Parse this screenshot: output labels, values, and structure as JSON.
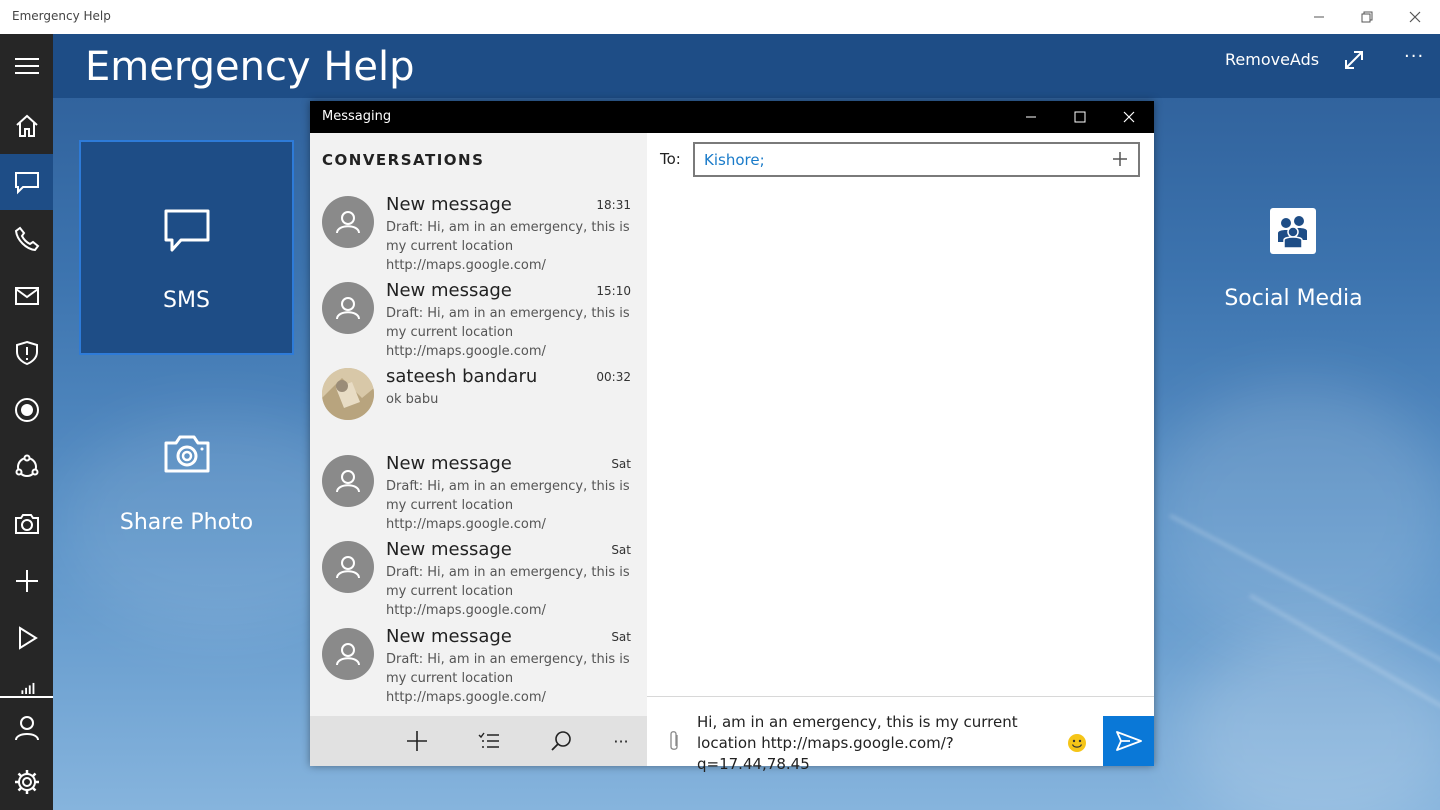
{
  "window": {
    "title": "Emergency Help"
  },
  "header": {
    "title": "Emergency Help",
    "remove_ads": "RemoveAds"
  },
  "tiles": {
    "sms": "SMS",
    "share_photo": "Share Photo",
    "social_media": "Social Media"
  },
  "messaging": {
    "title": "Messaging",
    "conversations_header": "CONVERSATIONS",
    "conversations": [
      {
        "name": "New message",
        "time": "18:31",
        "preview": "Draft: Hi, am in an emergency, this is my current location http://maps.google.com/"
      },
      {
        "name": "New message",
        "time": "15:10",
        "preview": "Draft: Hi, am in an emergency, this is my current location http://maps.google.com/"
      },
      {
        "name": "sateesh bandaru",
        "time": "00:32",
        "preview": "ok babu"
      },
      {
        "name": "New message",
        "time": "Sat",
        "preview": "Draft: Hi, am in an emergency, this is my current location http://maps.google.com/"
      },
      {
        "name": "New message",
        "time": "Sat",
        "preview": "Draft: Hi, am in an emergency, this is my current location http://maps.google.com/"
      },
      {
        "name": "New message",
        "time": "Sat",
        "preview": "Draft: Hi, am in an emergency, this is my current location http://maps.google.com/"
      }
    ],
    "to_label": "To:",
    "recipient": "Kishore;",
    "compose_text": "Hi, am in an emergency, this is my current location http://maps.google.com/?q=17.44,78.45",
    "accent": "#0a78d7"
  },
  "icons": {
    "rail": [
      "menu-icon",
      "home-icon",
      "message-icon",
      "phone-icon",
      "mail-icon",
      "shield-icon",
      "record-icon",
      "share-icon",
      "camera-icon",
      "add-icon",
      "play-icon",
      "signal-icon",
      "person-icon",
      "gear-icon"
    ]
  }
}
